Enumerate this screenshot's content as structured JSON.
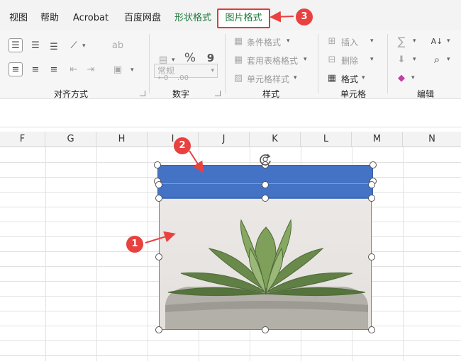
{
  "tabs": [
    {
      "label": "视图"
    },
    {
      "label": "帮助"
    },
    {
      "label": "Acrobat"
    },
    {
      "label": "百度网盘"
    },
    {
      "label": "形状格式"
    },
    {
      "label": "图片格式"
    }
  ],
  "ribbon": {
    "alignment": {
      "label": "对齐方式"
    },
    "number": {
      "label": "数字",
      "format_value": "常规",
      "percent": "%",
      "comma": "9"
    },
    "styles": {
      "label": "样式",
      "conditional": "条件格式",
      "table": "套用表格格式",
      "cell_styles": "单元格样式"
    },
    "cells": {
      "label": "单元格",
      "insert": "插入",
      "delete": "删除",
      "format": "格式"
    },
    "editing": {
      "label": "编辑",
      "sum": "∑"
    }
  },
  "columns": [
    "F",
    "G",
    "H",
    "I",
    "J",
    "K",
    "L",
    "M",
    "N"
  ],
  "annotations": [
    {
      "number": "1"
    },
    {
      "number": "2"
    },
    {
      "number": "3"
    }
  ],
  "colors": {
    "accent_red": "#e8413f",
    "shape_blue": "#4472c4",
    "tab_green": "#1e7a3c"
  }
}
